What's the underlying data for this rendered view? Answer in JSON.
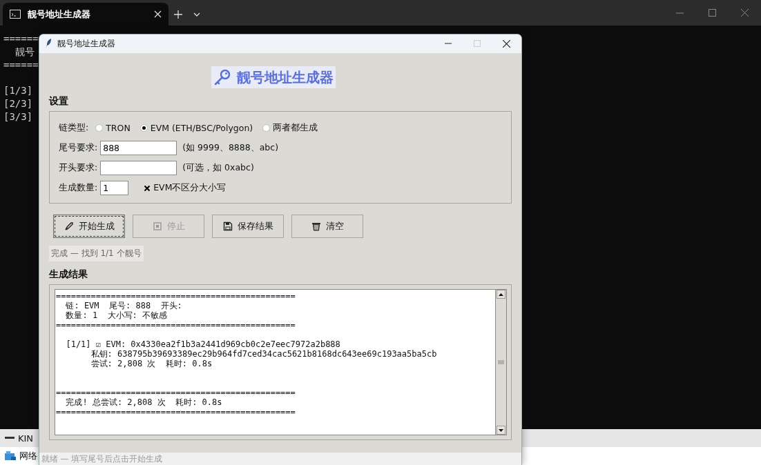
{
  "terminal": {
    "tab_title": "靓号地址生成器",
    "blocks": [
      [
        "======",
        "  靓号",
        "======"
      ],
      [
        "[1/3]",
        "[2/3]",
        "[3/3]"
      ]
    ]
  },
  "background_items": [
    {
      "label": "KIN"
    },
    {
      "label": "网络"
    }
  ],
  "dialog": {
    "title": "靓号地址生成器",
    "banner": "靓号地址生成器",
    "settings": {
      "heading": "设置",
      "chain_label": "链类型:",
      "chain_options": [
        {
          "label": "TRON",
          "selected": false
        },
        {
          "label": "EVM (ETH/BSC/Polygon)",
          "selected": true
        },
        {
          "label": "两者都生成",
          "selected": false
        }
      ],
      "fields": [
        {
          "label": "尾号要求:",
          "value": "888",
          "hint": "(如 9999、8888、abc)",
          "kind": "wide"
        },
        {
          "label": "开头要求:",
          "hint": "(可选，如 0xabc)",
          "kind": "wide"
        },
        {
          "label": "生成数量:",
          "value": "1",
          "kind": "narrow"
        }
      ],
      "case_option": {
        "label": "EVM不区分大小写",
        "checked": true
      }
    },
    "buttons": [
      {
        "label": "开始生成",
        "disabled": false,
        "focused": true
      },
      {
        "label": "停止",
        "disabled": true,
        "focused": false
      },
      {
        "label": "保存结果",
        "disabled": false,
        "focused": false
      },
      {
        "label": "清空",
        "disabled": false,
        "focused": false
      }
    ],
    "progress": "完成 — 找到 1/1 个靓号",
    "results": {
      "heading": "生成结果",
      "blocks": [
        {
          "kind": "header",
          "lines": [
            "================================================",
            "  链: EVM  尾号: 888  开头:",
            "  数量: 1  大小写: 不敏感",
            "================================================"
          ]
        },
        {
          "kind": "entry",
          "lines": [
            "  [1/1] ☑ EVM: 0x4330ea2f1b3a2441d969cb0c2e7eec7972a2b888",
            "       私钥: 638795b39693389ec29b964fd7ced34cac5621b8168dc643ee69c193aa5ba5cb",
            "       尝试: 2,808 次  耗时: 0.8s"
          ]
        },
        {
          "kind": "summary",
          "lines": [
            "================================================",
            "  完成! 总尝试: 2,808 次  耗时: 0.8s",
            "================================================"
          ]
        }
      ]
    },
    "status_bar": "就绪 — 填写尾号后点击开始生成"
  }
}
